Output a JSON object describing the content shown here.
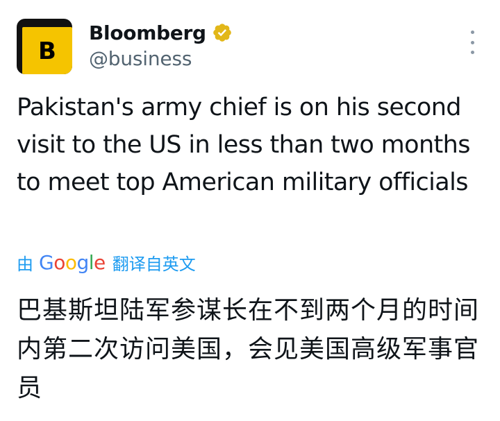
{
  "author": {
    "avatar_letter": "B",
    "display_name": "Bloomberg",
    "handle": "@business",
    "verified_icon": "gold-verified-badge",
    "avatar_colors": {
      "frame": "#111111",
      "fill": "#f5c400"
    }
  },
  "menu": {
    "icon": "more-vertical-icon"
  },
  "tweet": {
    "text": "Pakistan's army chief is on his second visit to the US in less than two months to meet top American military officials"
  },
  "translation": {
    "by_label": "由",
    "provider": "Google",
    "action_label": "翻译自英文",
    "text": "巴基斯坦陆军参谋长在不到两个月的时间内第二次访问美国，会见美国高级军事官员",
    "link_color": "#1d9bf0"
  }
}
